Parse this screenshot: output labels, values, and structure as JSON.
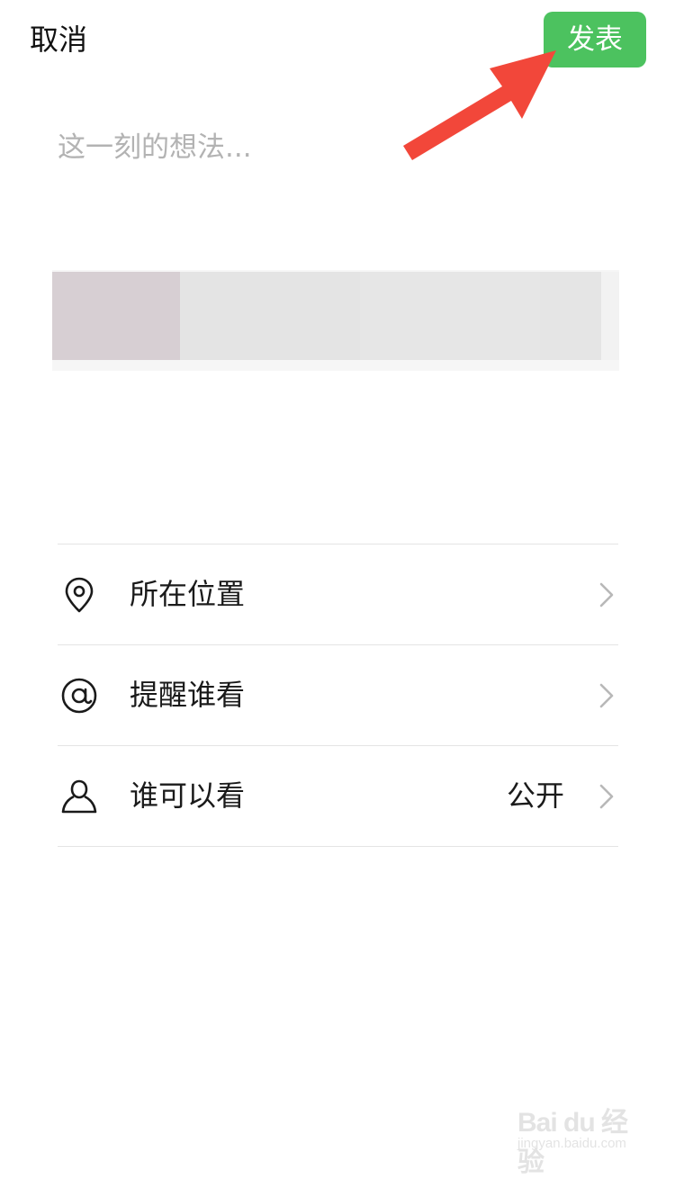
{
  "header": {
    "cancel_label": "取消",
    "publish_label": "发表"
  },
  "composer": {
    "placeholder": "这一刻的想法...",
    "value": ""
  },
  "options": [
    {
      "label": "所在位置",
      "value": "",
      "icon": "location-pin-icon"
    },
    {
      "label": "提醒谁看",
      "value": "",
      "icon": "at-sign-icon"
    },
    {
      "label": "谁可以看",
      "value": "公开",
      "icon": "person-icon"
    }
  ],
  "watermark": {
    "main": "Bai du 经验",
    "sub": "jingyan.baidu.com"
  },
  "colors": {
    "publish_bg": "#4cc25f",
    "arrow": "#f2473a",
    "placeholder": "#b3b3b3",
    "divider": "#e4e4e4"
  }
}
